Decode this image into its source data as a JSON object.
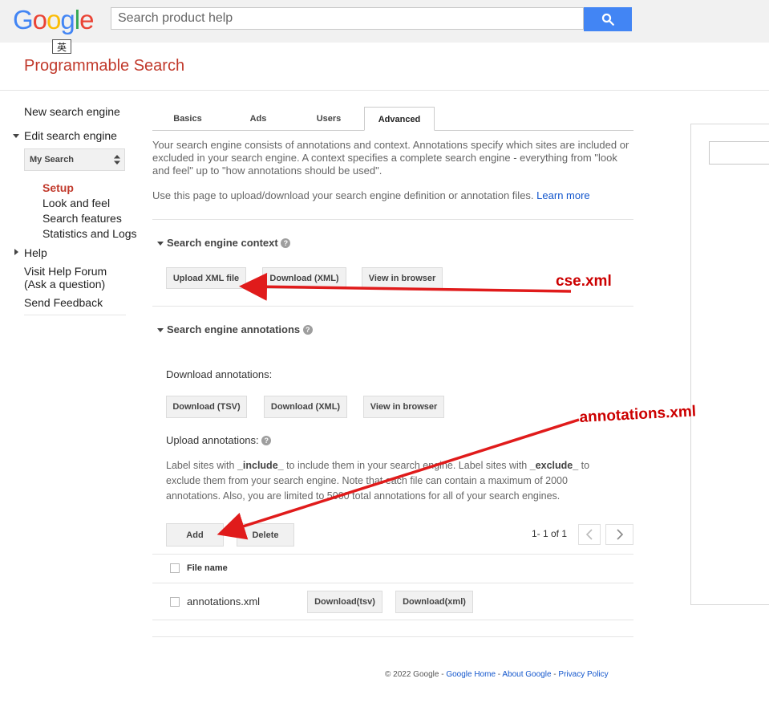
{
  "header": {
    "logo": [
      "G",
      "o",
      "o",
      "g",
      "l",
      "e"
    ],
    "logo_colors": [
      "#4285F4",
      "#EA4335",
      "#FBBC05",
      "#4285F4",
      "#34A853",
      "#EA4335"
    ],
    "search_placeholder": "Search product help",
    "lang_badge": "英",
    "product_title": "Programmable Search"
  },
  "sidebar": {
    "new_engine": "New search engine",
    "edit_engine": "Edit search engine",
    "engine_select": "My Search",
    "items": [
      "Setup",
      "Look and feel",
      "Search features",
      "Statistics and Logs"
    ],
    "help": "Help",
    "forum_line1": "Visit Help Forum",
    "forum_line2": "(Ask a question)",
    "feedback": "Send Feedback"
  },
  "tabs": [
    "Basics",
    "Ads",
    "Users",
    "Advanced"
  ],
  "intro": {
    "p1": "Your search engine consists of annotations and context. Annotations specify which sites are included or excluded in your search engine. A context specifies a complete search engine - everything from \"look and feel\" up to \"how annotations should be used\".",
    "p2": "Use this page to upload/download your search engine definition or annotation files.",
    "learn_more": "Learn more"
  },
  "context_section": {
    "title": "Search engine context",
    "upload": "Upload XML file",
    "download_xml": "Download (XML)",
    "view": "View in browser"
  },
  "annotations_section": {
    "title": "Search engine annotations",
    "download_label": "Download annotations:",
    "download_tsv": "Download (TSV)",
    "download_xml": "Download (XML)",
    "view": "View in browser",
    "upload_label": "Upload annotations:",
    "desc_a": "Label sites with ",
    "include": "_include_",
    "desc_b": " to include them in your search engine. Label sites with ",
    "exclude": "_exclude_",
    "desc_c": " to exclude them from your search engine. Note that each file can contain a maximum of 2000 annotations. Also, you are limited to 5000 total annotations for all of your search engines.",
    "add": "Add",
    "delete": "Delete",
    "pager": "1- 1 of 1"
  },
  "file_table": {
    "header": "File name",
    "rows": [
      {
        "name": "annotations.xml",
        "tsv": "Download(tsv)",
        "xml": "Download(xml)"
      }
    ]
  },
  "annotations_overlay": {
    "cse": "cse.xml",
    "annotations": "annotations.xml",
    "arrow_color": "#e01b1b"
  },
  "footer": {
    "copyright": "© 2022 Google",
    "sep": " - ",
    "links": [
      "Google Home",
      "About Google",
      "Privacy Policy"
    ]
  }
}
